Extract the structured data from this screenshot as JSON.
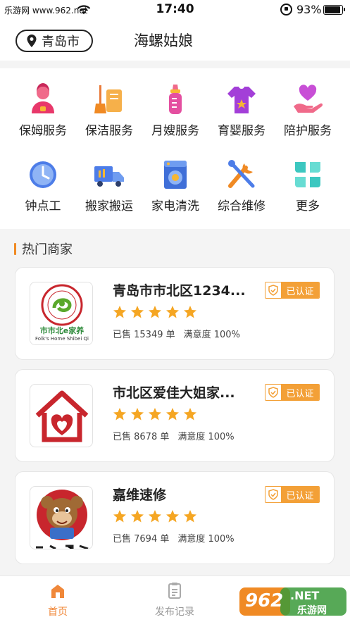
{
  "status_bar": {
    "carrier": "乐游网 www.962.net",
    "time": "17:40",
    "battery_percent": "93%",
    "battery_level": 0.93
  },
  "header": {
    "city": "青岛市",
    "title": "海螺姑娘"
  },
  "services": [
    {
      "label": "保姆服务",
      "icon": "nanny-icon"
    },
    {
      "label": "保洁服务",
      "icon": "cleaning-icon"
    },
    {
      "label": "月嫂服务",
      "icon": "baby-bottle-icon"
    },
    {
      "label": "育婴服务",
      "icon": "baby-clothes-icon"
    },
    {
      "label": "陪护服务",
      "icon": "care-heart-icon"
    },
    {
      "label": "钟点工",
      "icon": "clock-icon"
    },
    {
      "label": "搬家搬运",
      "icon": "moving-truck-icon"
    },
    {
      "label": "家电清洗",
      "icon": "washing-machine-icon"
    },
    {
      "label": "综合维修",
      "icon": "repair-tools-icon"
    },
    {
      "label": "更多",
      "icon": "more-grid-icon"
    }
  ],
  "hot_section": {
    "title": "热门商家"
  },
  "merchants": [
    {
      "name": "青岛市市北区1234...",
      "badge": "已认证",
      "rating": 5,
      "sold": "已售 15349 单",
      "satisfaction": "满意度 100%",
      "logo_text": "市市北e家养",
      "logo_subtext": "Folk's Home Shibei Qi"
    },
    {
      "name": "市北区爱佳大姐家...",
      "badge": "已认证",
      "rating": 5,
      "sold": "已售 8678 单",
      "satisfaction": "满意度 100%"
    },
    {
      "name": "嘉维速修",
      "badge": "已认证",
      "rating": 5,
      "sold": "已售 7694 单",
      "satisfaction": "满意度 100%"
    }
  ],
  "tabbar": {
    "tabs": [
      {
        "label": "首页",
        "icon": "home-icon",
        "active": true
      },
      {
        "label": "发布记录",
        "icon": "document-icon",
        "active": false
      }
    ]
  },
  "watermark": {
    "text_962": "962",
    "text_net": ".NET",
    "text_cn": "乐游网"
  },
  "colors": {
    "accent": "#f0883a",
    "badge": "#f3a037",
    "star": "#f5a623"
  }
}
